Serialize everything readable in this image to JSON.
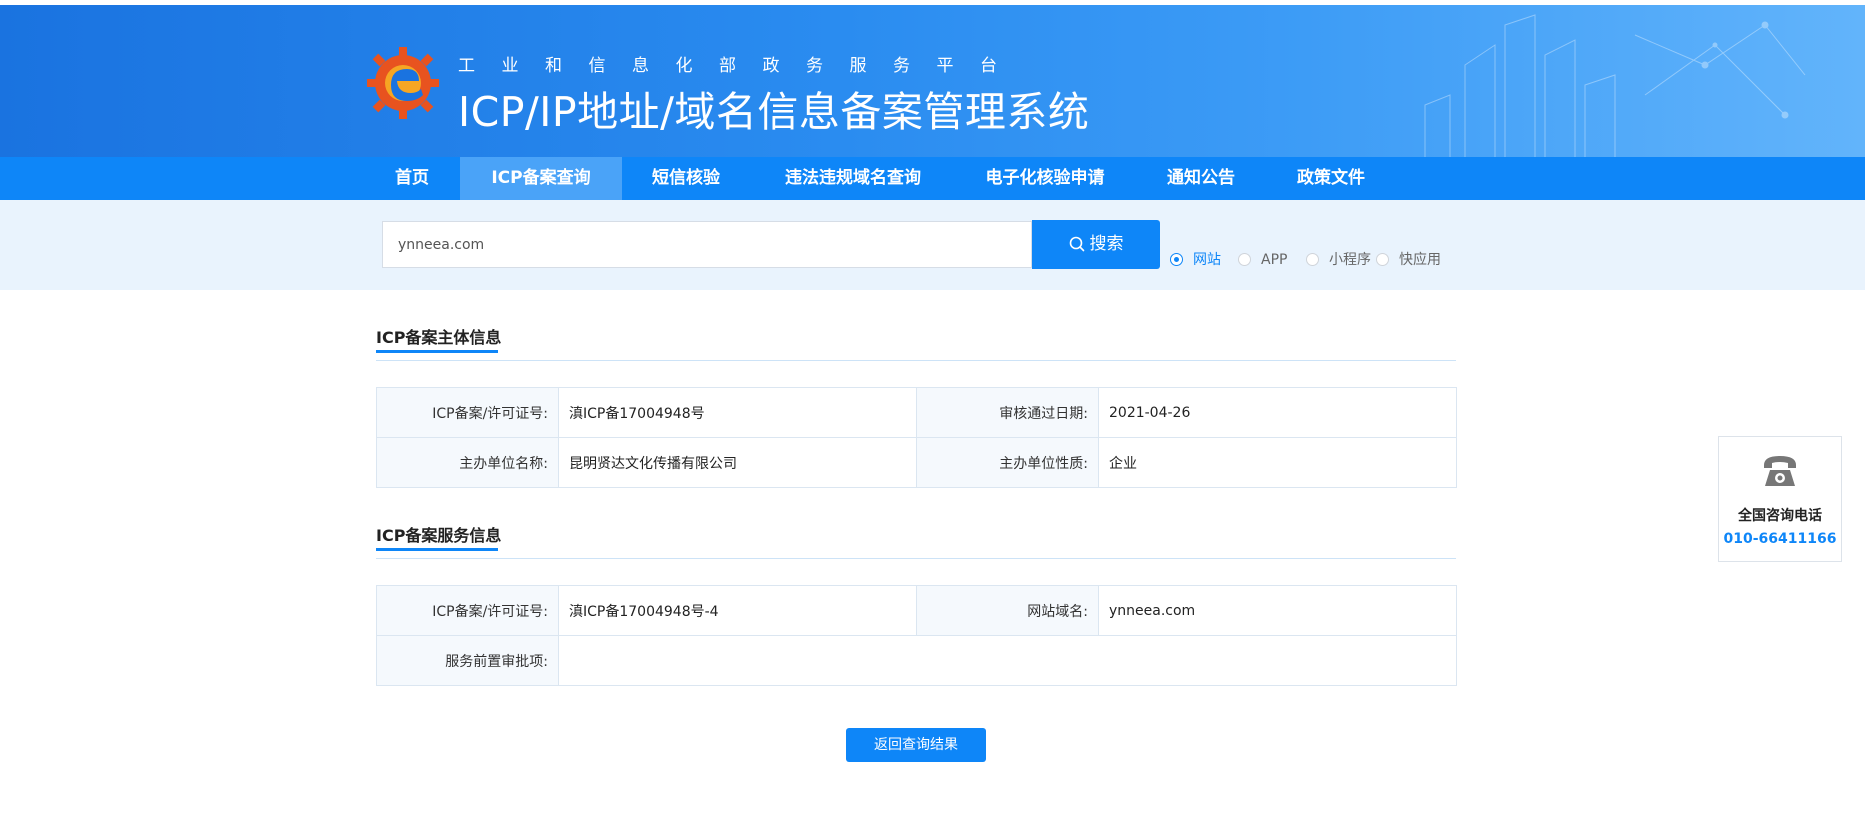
{
  "header": {
    "sub_title": "工业和信息化部政务服务平台",
    "main_title": "ICP/IP地址/域名信息备案管理系统",
    "brand_color": "#0e86f8"
  },
  "nav": {
    "items": [
      {
        "label": "首页",
        "active": false
      },
      {
        "label": "ICP备案查询",
        "active": true
      },
      {
        "label": "短信核验",
        "active": false
      },
      {
        "label": "违法违规域名查询",
        "active": false
      },
      {
        "label": "电子化核验申请",
        "active": false
      },
      {
        "label": "通知公告",
        "active": false
      },
      {
        "label": "政策文件",
        "active": false
      }
    ]
  },
  "search": {
    "value": "ynneea.com",
    "button_label": "搜索",
    "button_icon": "search-icon",
    "types": [
      {
        "label": "网站",
        "checked": true
      },
      {
        "label": "APP",
        "checked": false
      },
      {
        "label": "小程序",
        "checked": false
      },
      {
        "label": "快应用",
        "checked": false
      }
    ]
  },
  "subject_info": {
    "title": "ICP备案主体信息",
    "rows": [
      {
        "label1": "ICP备案/许可证号:",
        "value1": "滇ICP备17004948号",
        "label2": "审核通过日期:",
        "value2": "2021-04-26"
      },
      {
        "label1": "主办单位名称:",
        "value1": "昆明贤达文化传播有限公司",
        "label2": "主办单位性质:",
        "value2": "企业"
      }
    ]
  },
  "service_info": {
    "title": "ICP备案服务信息",
    "rows": [
      {
        "label1": "ICP备案/许可证号:",
        "value1": "滇ICP备17004948号-4",
        "label2": "网站域名:",
        "value2": "ynneea.com"
      },
      {
        "label1": "服务前置审批项:",
        "value1": ""
      }
    ]
  },
  "back_button": "返回查询结果",
  "consult": {
    "icon": "telephone-icon",
    "label": "全国咨询电话",
    "phone": "010-66411166"
  }
}
